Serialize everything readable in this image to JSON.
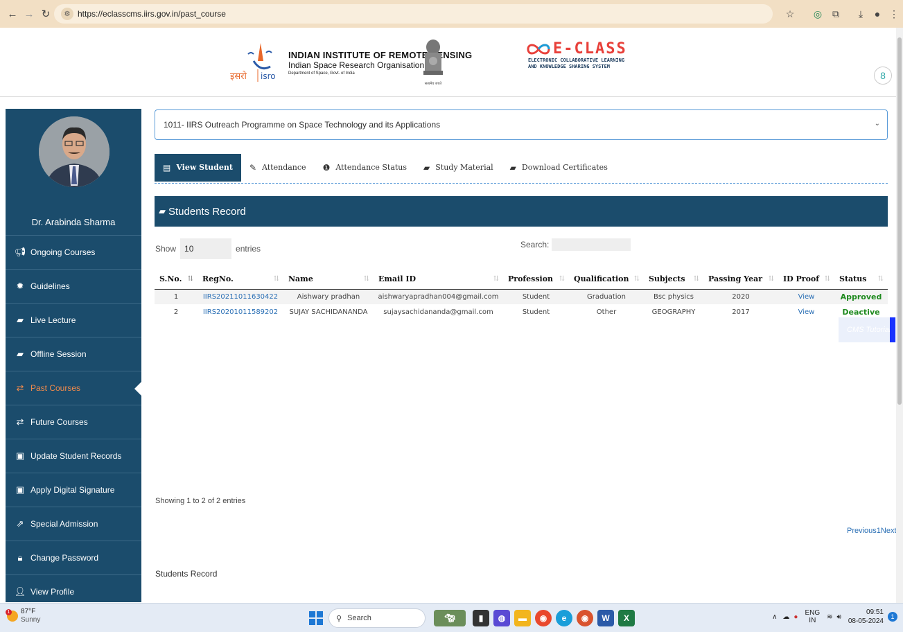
{
  "browser": {
    "url": "https://eclasscms.iirs.gov.in/past_course"
  },
  "header": {
    "isro_title": "INDIAN INSTITUTE OF REMOTE SENSING",
    "isro_subtitle": "Indian Space Research Organisation",
    "isro_dept": "Department of Space, Govt. of India",
    "isro_logo_text": "इसरो isro",
    "emblem_motto": "सत्यमेव जयते",
    "eclass_title": "E-CLASS",
    "eclass_sub_line1": "ELECTRONIC COLLABORATIVE LEARNING",
    "eclass_sub_line2": "AND KNOWLEDGE SHARING SYSTEM"
  },
  "sidebar": {
    "profile_name": "Dr. Arabinda Sharma",
    "items": [
      {
        "label": "Ongoing Courses",
        "icon": "megaphone-icon"
      },
      {
        "label": "Guidelines",
        "icon": "gear-icon"
      },
      {
        "label": "Live Lecture",
        "icon": "book-icon"
      },
      {
        "label": "Offline Session",
        "icon": "book-icon"
      },
      {
        "label": "Past Courses",
        "icon": "exchange-icon"
      },
      {
        "label": "Future Courses",
        "icon": "exchange-icon"
      },
      {
        "label": "Update Student Records",
        "icon": "person-badge-icon"
      },
      {
        "label": "Apply Digital Signature",
        "icon": "person-badge-icon"
      },
      {
        "label": "Special Admission",
        "icon": "external-link-icon"
      },
      {
        "label": "Change Password",
        "icon": "lock-icon"
      },
      {
        "label": "View Profile",
        "icon": "user-icon"
      }
    ],
    "active_item": "Past Courses"
  },
  "main": {
    "course_selected": "1011- IIRS Outreach Programme on Space Technology and its Applications",
    "tabs": [
      {
        "label": "View Student",
        "icon": "list-icon"
      },
      {
        "label": "Attendance",
        "icon": "pencil-icon"
      },
      {
        "label": "Attendance Status",
        "icon": "info-circle-icon"
      },
      {
        "label": "Study Material",
        "icon": "book-icon"
      },
      {
        "label": "Download Certificates",
        "icon": "book-icon"
      }
    ],
    "active_tab": "View Student",
    "records_title": "Students Record",
    "show_label": "Show",
    "entries_value": "10",
    "entries_label": "entries",
    "search_label": "Search:",
    "search_value": "",
    "table": {
      "columns": [
        "S.No.",
        "RegNo.",
        "Name",
        "Email ID",
        "Profession",
        "Qualification",
        "Subjects",
        "Passing Year",
        "ID Proof",
        "Status"
      ],
      "rows": [
        [
          "1",
          "IIRS20211011630422",
          "Aishwary pradhan",
          "aishwaryapradhan004@gmail.com",
          "Student",
          "Graduation",
          "Bsc physics",
          "2020",
          "View",
          "Approved"
        ],
        [
          "2",
          "IIRS20201011589202",
          "SUJAY SACHIDANANDA",
          "sujaysachidananda@gmail.com",
          "Student",
          "Other",
          "GEOGRAPHY",
          "2017",
          "View",
          "Deactive"
        ]
      ]
    },
    "showing_info": "Showing 1 to 2 of 2 entries",
    "pagination": "Previous1Next",
    "footer_caption": "Students Record",
    "cms_tutorial": "CMS Tutorial"
  },
  "taskbar": {
    "weather_temp": "87°F",
    "weather_desc": "Sunny",
    "weather_alert": "1",
    "search_placeholder": "Search",
    "lang": "ENG",
    "region": "IN",
    "time": "09:51",
    "date": "08-05-2024",
    "notifications": "1"
  }
}
